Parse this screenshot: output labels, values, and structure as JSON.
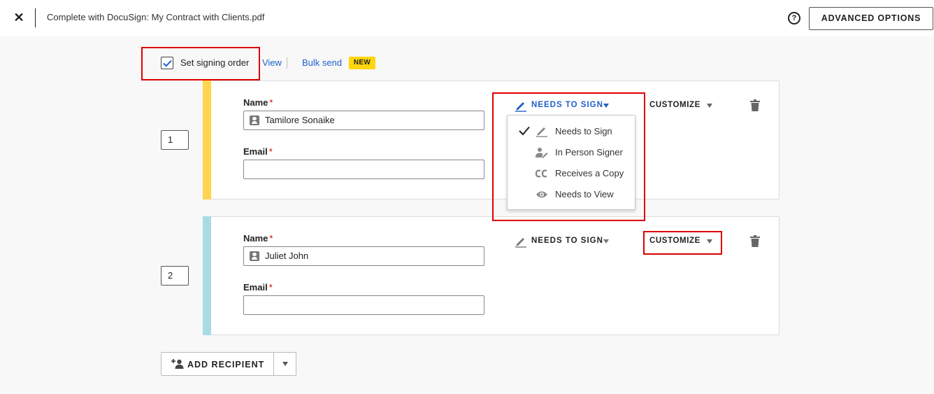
{
  "header": {
    "close_glyph": "✕",
    "title": "Complete with DocuSign: My Contract with Clients.pdf",
    "help_glyph": "?",
    "advanced_options_label": "ADVANCED OPTIONS"
  },
  "signing_order": {
    "label": "Set signing order",
    "checked": true,
    "view_link": "View",
    "bulk_send_link": "Bulk send",
    "new_badge": "NEW"
  },
  "recipients": [
    {
      "order": "1",
      "stripe_color": "#ffd54f",
      "name_label": "Name",
      "name_value": "Tamilore Sonaike",
      "email_label": "Email",
      "email_value": "",
      "required_marker": "*",
      "role_label": "NEEDS TO SIGN",
      "role_active": true,
      "customize_label": "CUSTOMIZE"
    },
    {
      "order": "2",
      "stripe_color": "#a8dbe4",
      "name_label": "Name",
      "name_value": "Juliet John",
      "email_label": "Email",
      "email_value": "",
      "required_marker": "*",
      "role_label": "NEEDS TO SIGN",
      "role_active": false,
      "customize_label": "CUSTOMIZE"
    }
  ],
  "role_menu": {
    "items": [
      {
        "label": "Needs to Sign",
        "icon": "pen-icon",
        "selected": true
      },
      {
        "label": "In Person Signer",
        "icon": "person-sign-icon",
        "selected": false
      },
      {
        "label": "Receives a Copy",
        "icon": "cc-icon",
        "selected": false
      },
      {
        "label": "Needs to View",
        "icon": "eye-icon",
        "selected": false
      }
    ]
  },
  "add_recipient": {
    "label": "ADD RECIPIENT"
  },
  "colors": {
    "accent_blue": "#1f5fc9",
    "highlight_red": "#dd0000",
    "badge_yellow": "#ffd60a"
  }
}
